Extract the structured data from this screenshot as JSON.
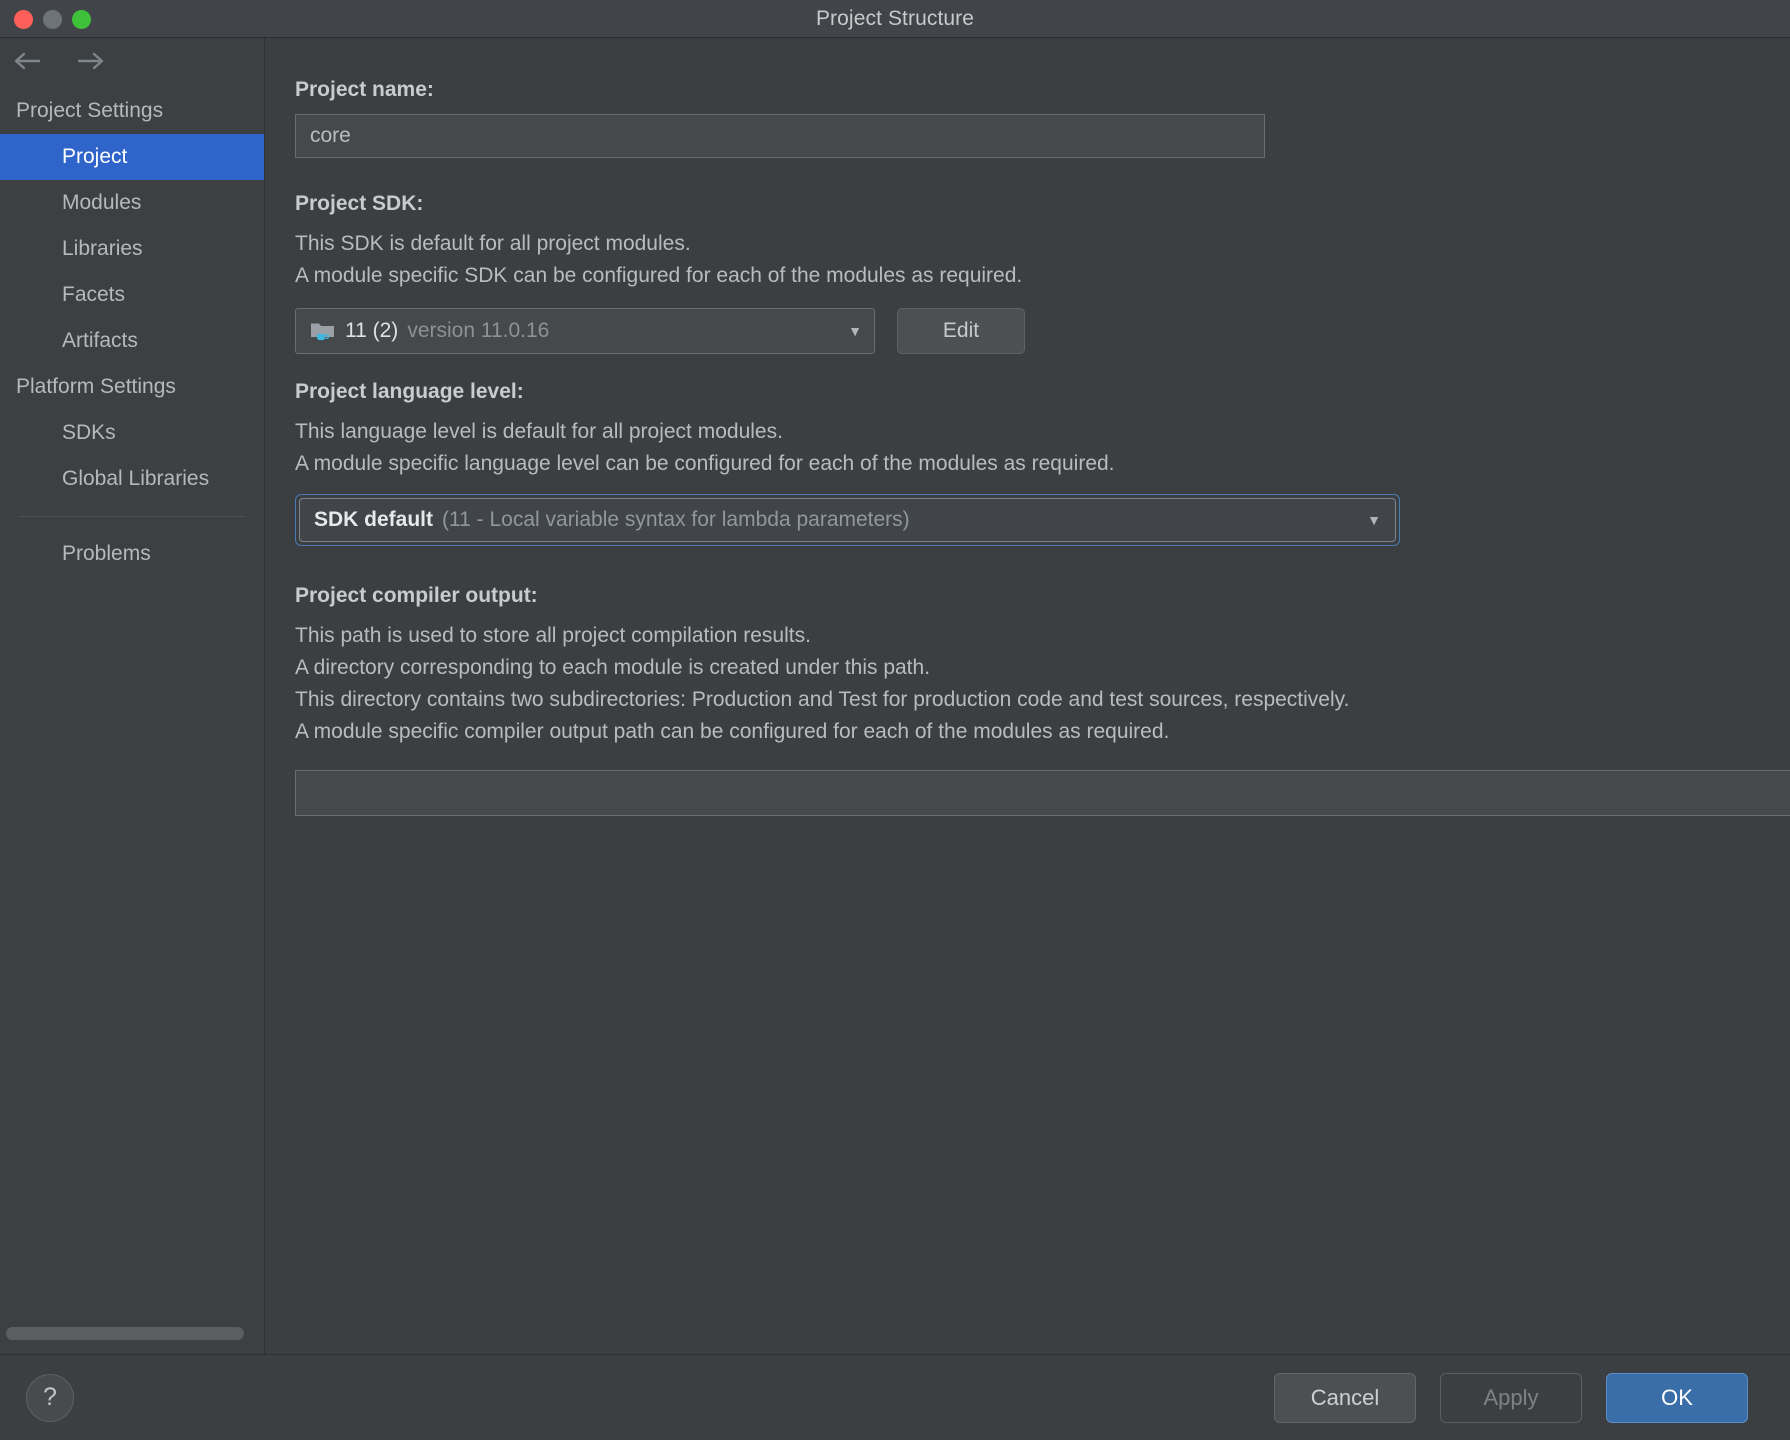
{
  "window": {
    "title": "Project Structure",
    "traffic_lights": [
      "close",
      "minimize",
      "zoom"
    ]
  },
  "sidebar": {
    "nav": {
      "back": "back-arrow",
      "forward": "forward-arrow"
    },
    "groups": [
      {
        "label": "Project Settings",
        "items": [
          {
            "label": "Project",
            "selected": true
          },
          {
            "label": "Modules",
            "selected": false
          },
          {
            "label": "Libraries",
            "selected": false
          },
          {
            "label": "Facets",
            "selected": false
          },
          {
            "label": "Artifacts",
            "selected": false
          }
        ]
      },
      {
        "label": "Platform Settings",
        "items": [
          {
            "label": "SDKs",
            "selected": false
          },
          {
            "label": "Global Libraries",
            "selected": false
          }
        ]
      }
    ],
    "problems": {
      "label": "Problems"
    }
  },
  "main": {
    "project_name": {
      "label": "Project name:",
      "value": "core",
      "placeholder": ""
    },
    "project_sdk": {
      "label": "Project SDK:",
      "desc1": "This SDK is default for all project modules.",
      "desc2": "A module specific SDK can be configured for each of the modules as required.",
      "selected_main": "11 (2)",
      "selected_sub": "version 11.0.16",
      "icon": "java-sdk-folder-icon",
      "edit_label": "Edit"
    },
    "language_level": {
      "label": "Project language level:",
      "desc1": "This language level is default for all project modules.",
      "desc2": "A module specific language level can be configured for each of the modules as required.",
      "selected_main": "SDK default",
      "selected_sub": "(11 - Local variable syntax for lambda parameters)"
    },
    "compiler_output": {
      "label": "Project compiler output:",
      "desc1": "This path is used to store all project compilation results.",
      "desc2": "A directory corresponding to each module is created under this path.",
      "desc3": "This directory contains two subdirectories: Production and Test for production code and test sources, respectively.",
      "desc4": "A module specific compiler output path can be configured for each of the modules as required.",
      "value": "",
      "browse_icon": "folder-open-icon"
    }
  },
  "footer": {
    "help_label": "?",
    "cancel_label": "Cancel",
    "apply_label": "Apply",
    "ok_label": "OK"
  },
  "colors": {
    "accent_selection": "#2f65cb",
    "ok_button": "#3a6ea8",
    "focus_ring": "#4a7ab5",
    "sdk_icon_cup": "#40b6e0",
    "window_bg": "#3c3f41",
    "sidebar_bg": "#3c4043",
    "titlebar_bg": "#41454a"
  }
}
